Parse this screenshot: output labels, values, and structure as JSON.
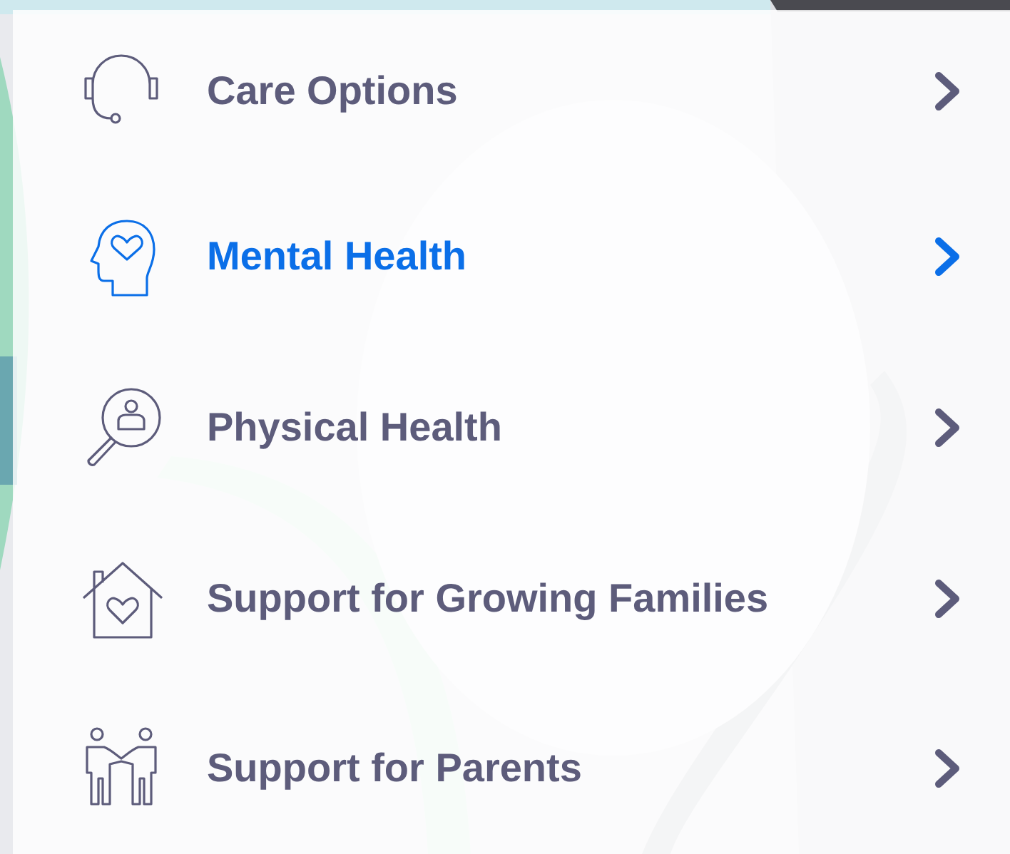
{
  "menu": {
    "items": [
      {
        "kind": "headset",
        "label": "Care Options",
        "selected": false
      },
      {
        "kind": "head-heart",
        "label": "Mental Health",
        "selected": true
      },
      {
        "kind": "magnifier-person",
        "label": "Physical Health",
        "selected": false
      },
      {
        "kind": "house-heart",
        "label": "Support for Growing Families",
        "selected": false
      },
      {
        "kind": "two-people",
        "label": "Support for Parents",
        "selected": false
      }
    ]
  }
}
